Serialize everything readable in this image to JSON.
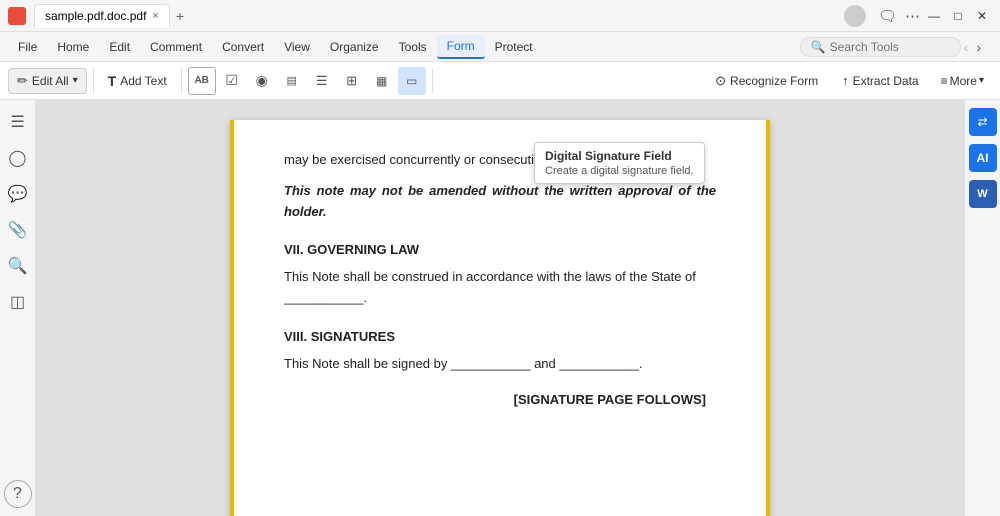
{
  "titlebar": {
    "logo_color": "#e74c3c",
    "tab_title": "sample.pdf.doc.pdf",
    "close_tab": "×",
    "add_tab": "+",
    "controls": {
      "minimize": "—",
      "maximize": "□",
      "close": "✕"
    }
  },
  "menubar": {
    "file": "File",
    "items": [
      {
        "id": "home",
        "label": "Home"
      },
      {
        "id": "edit",
        "label": "Edit"
      },
      {
        "id": "comment",
        "label": "Comment"
      },
      {
        "id": "convert",
        "label": "Convert"
      },
      {
        "id": "view",
        "label": "View"
      },
      {
        "id": "organize",
        "label": "Organize"
      },
      {
        "id": "tools",
        "label": "Tools"
      },
      {
        "id": "form",
        "label": "Form",
        "active": true
      },
      {
        "id": "protect",
        "label": "Protect"
      }
    ],
    "search_placeholder": "Search Tools",
    "nav_back": "‹",
    "nav_forward": "›"
  },
  "toolbar": {
    "edit_all": "Edit All",
    "edit_icon": "✏",
    "add_text": "Add Text",
    "text_icon": "T",
    "buttons": [
      {
        "id": "ab-field",
        "icon": "AB",
        "label": "Text Field"
      },
      {
        "id": "checkbox",
        "icon": "☑",
        "label": "Checkbox"
      },
      {
        "id": "radio",
        "icon": "⊙",
        "label": "Radio"
      },
      {
        "id": "combo",
        "icon": "▤",
        "label": "Combo Box"
      },
      {
        "id": "list",
        "icon": "☰",
        "label": "List Box"
      },
      {
        "id": "image",
        "icon": "⊞",
        "label": "Image"
      },
      {
        "id": "date",
        "icon": "▦",
        "label": "Date"
      },
      {
        "id": "sig",
        "icon": "▭",
        "label": "Signature",
        "active": true
      }
    ],
    "recognize_form": "Recognize Form",
    "extract_data": "Extract Data",
    "more": "More",
    "more_icon": "≡"
  },
  "tooltip": {
    "title": "Digital Signature Field",
    "description": "Create a digital signature field."
  },
  "left_sidebar": {
    "icons": [
      {
        "id": "nav",
        "icon": "☰"
      },
      {
        "id": "bookmark",
        "icon": "⊙"
      },
      {
        "id": "comment",
        "icon": "💬"
      },
      {
        "id": "attachment",
        "icon": "📎"
      },
      {
        "id": "search",
        "icon": "🔍"
      },
      {
        "id": "layers",
        "icon": "◫"
      }
    ],
    "bottom": {
      "id": "help",
      "icon": "?"
    }
  },
  "document": {
    "cut_text": "may be exercised concurrently or consecutively (                                              ).",
    "bold_italic_note": "This note may not be amended without the written approval of the holder.",
    "section7_title": "VII. GOVERNING LAW",
    "section7_text": "This Note shall be construed in accordance with the laws of the State of",
    "section7_blank": "___________.",
    "section8_title": "VIII. SIGNATURES",
    "section8_text": "This Note shall be signed by ___________ and ___________.",
    "signature_block": "[SIGNATURE PAGE FOLLOWS]"
  },
  "right_sidebar": {
    "icons": [
      {
        "id": "convert",
        "icon": "⇄",
        "type": "blue"
      },
      {
        "id": "ai",
        "icon": "AI",
        "type": "ai"
      },
      {
        "id": "word",
        "icon": "W",
        "type": "word"
      }
    ]
  }
}
